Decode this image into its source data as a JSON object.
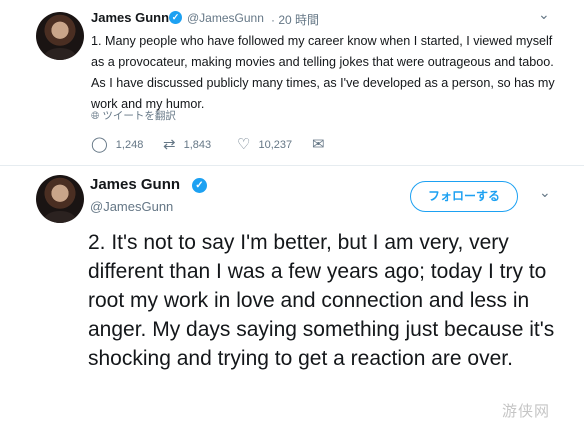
{
  "tweet1": {
    "author_name": "James Gunn",
    "handle": "@JamesGunn",
    "time": "· 20 時間",
    "text": "1. Many people who have followed my career know when I started, I viewed myself as a provocateur, making movies and telling jokes that were outrageous and taboo. As I have discussed publicly many times, as I've developed as a person, so has my work and my humor.",
    "translate_label": "ツイートを翻訳",
    "replies": "1,248",
    "retweets": "1,843",
    "likes": "10,237"
  },
  "tweet2": {
    "author_name": "James Gunn",
    "handle": "@JamesGunn",
    "follow_label": "フォローする",
    "text": "2. It's not to say I'm better, but I am very, very different than I was a few years ago; today I try to root my work in love and connection and less in anger.  My days saying something just because it's shocking and trying to get a reaction are over."
  },
  "watermark": "游侠网",
  "icons": {
    "verified": "verified-badge-icon",
    "chevron": "chevron-down-icon",
    "globe": "globe-icon",
    "reply": "reply-icon",
    "retweet": "retweet-icon",
    "like": "heart-icon",
    "message": "envelope-icon"
  },
  "colors": {
    "accent": "#1da1f2",
    "muted": "#657786",
    "text": "#14171a"
  }
}
